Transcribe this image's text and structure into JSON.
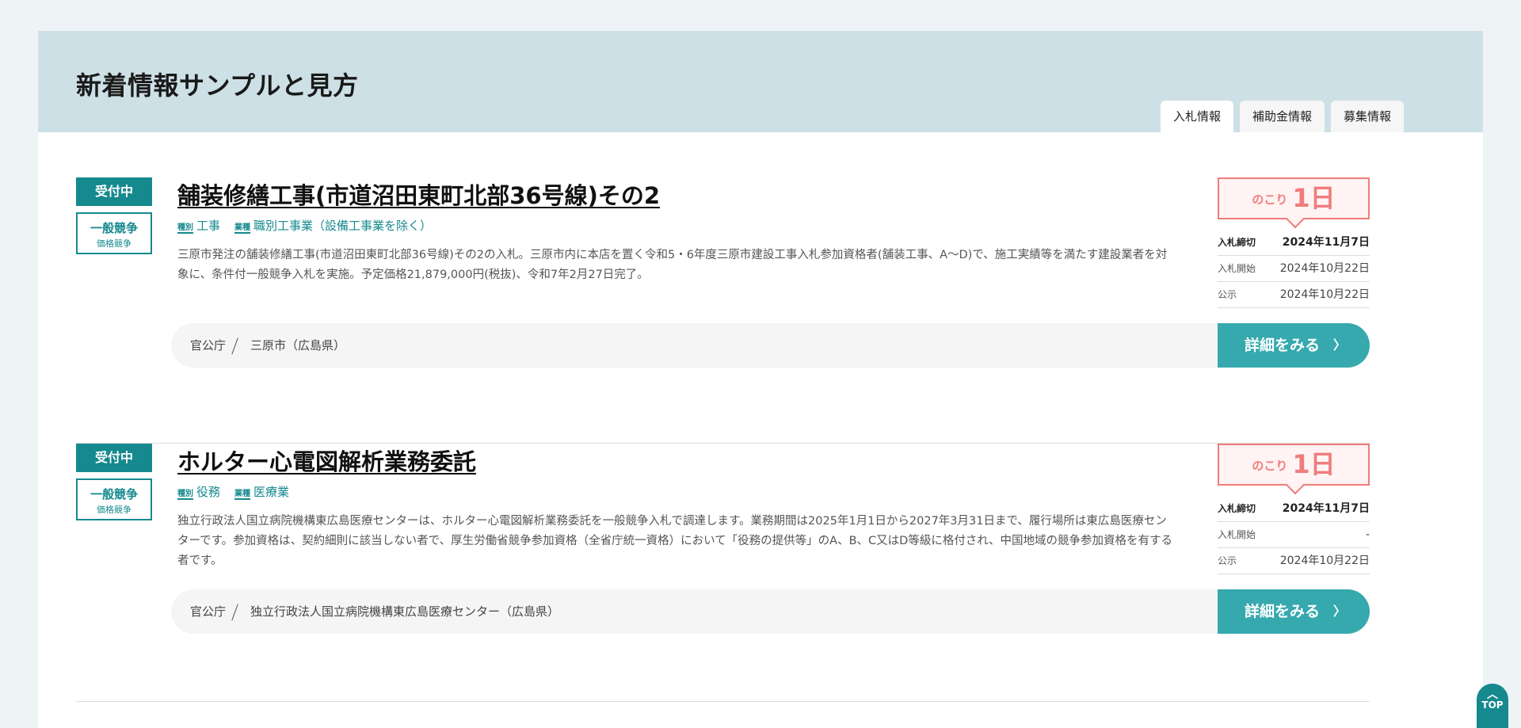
{
  "page": {
    "title": "新着情報サンプルと見方",
    "tabs": [
      {
        "label": "入札情報",
        "active": true
      },
      {
        "label": "補助金情報",
        "active": false
      },
      {
        "label": "募集情報",
        "active": false
      }
    ]
  },
  "items": [
    {
      "status": "受付中",
      "type_main": "一般競争",
      "type_sub": "価格競争",
      "title": "舗装修繕工事(市道沼田東町北部36号線)その2",
      "kind_label": "種別",
      "kind": "工事",
      "field_label": "業種",
      "field": "職別工事業（設備工事業を除く）",
      "description": "三原市発注の舗装修繕工事(市道沼田東町北部36号線)その2の入札。三原市内に本店を置く令和5・6年度三原市建設工事入札参加資格者(舗装工事、A〜D)で、施工実績等を満たす建設業者を対象に、条件付一般競争入札を実施。予定価格21,879,000円(税抜)、令和7年2月27日完了。",
      "org_category": "官公庁",
      "org": "三原市（広島県）",
      "remaining_prefix": "のこり",
      "remaining": "1日",
      "deadline_label": "入札締切",
      "deadline": "2024年11月7日",
      "start_label": "入札開始",
      "start": "2024年10月22日",
      "notice_label": "公示",
      "notice": "2024年10月22日",
      "detail_label": "詳細をみる"
    },
    {
      "status": "受付中",
      "type_main": "一般競争",
      "type_sub": "価格競争",
      "title": "ホルター心電図解析業務委託",
      "kind_label": "種別",
      "kind": "役務",
      "field_label": "業種",
      "field": "医療業",
      "description": "独立行政法人国立病院機構東広島医療センターは、ホルター心電図解析業務委託を一般競争入札で調達します。業務期間は2025年1月1日から2027年3月31日まで、履行場所は東広島医療センターです。参加資格は、契約細則に該当しない者で、厚生労働省競争参加資格（全省庁統一資格）において「役務の提供等」のA、B、C又はD等級に格付され、中国地域の競争参加資格を有する者です。",
      "org_category": "官公庁",
      "org": "独立行政法人国立病院機構東広島医療センター（広島県）",
      "remaining_prefix": "のこり",
      "remaining": "1日",
      "deadline_label": "入札締切",
      "deadline": "2024年11月7日",
      "start_label": "入札開始",
      "start": "-",
      "notice_label": "公示",
      "notice": "2024年10月22日",
      "detail_label": "詳細をみる"
    }
  ],
  "top_button": {
    "label": "TOP",
    "icon": "chevron-up-icon"
  },
  "colors": {
    "accent": "#15898e",
    "button": "#36a9ae",
    "remaining": "#f07c7c",
    "header_bg": "#cde0e6"
  }
}
